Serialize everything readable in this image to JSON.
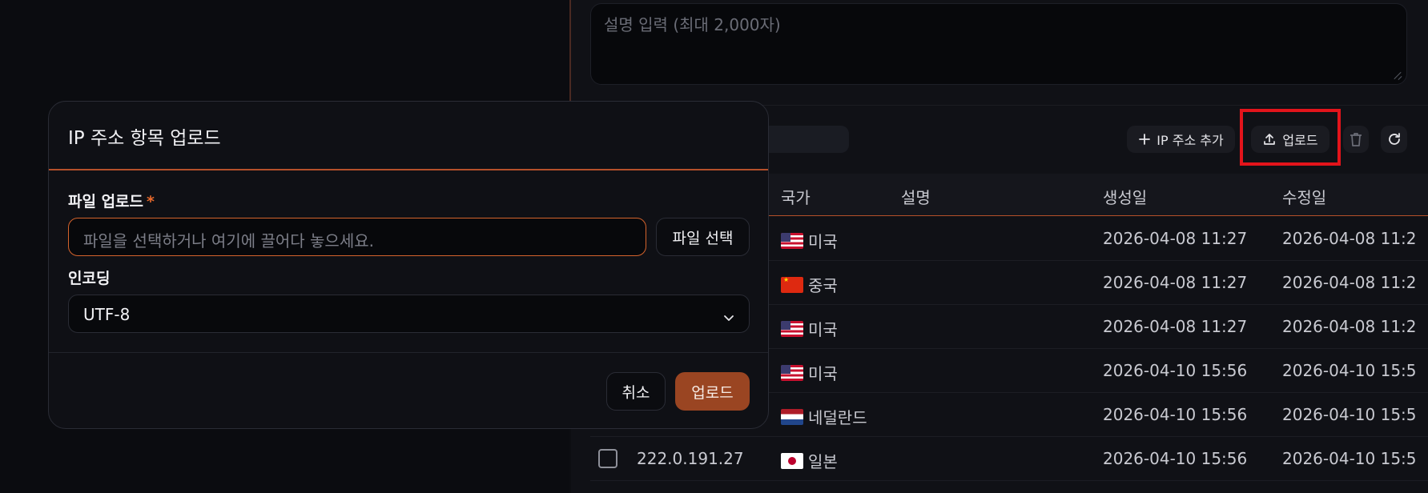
{
  "background": {
    "description_placeholder": "설명 입력 (최대 2,000자)"
  },
  "toolbar": {
    "add_ip_label": "IP 주소 추가",
    "upload_label": "업로드"
  },
  "table": {
    "headers": {
      "country": "국가",
      "description": "설명",
      "created": "생성일",
      "modified": "수정일"
    },
    "rows": [
      {
        "ip": "",
        "country": "미국",
        "flag": "us",
        "created": "2026-04-08 11:27",
        "modified": "2026-04-08 11:2"
      },
      {
        "ip": "",
        "country": "중국",
        "flag": "cn",
        "created": "2026-04-08 11:27",
        "modified": "2026-04-08 11:2"
      },
      {
        "ip": "",
        "country": "미국",
        "flag": "us",
        "created": "2026-04-08 11:27",
        "modified": "2026-04-08 11:2"
      },
      {
        "ip": "",
        "country": "미국",
        "flag": "us",
        "created": "2026-04-10 15:56",
        "modified": "2026-04-10 15:5"
      },
      {
        "ip": "",
        "country": "네덜란드",
        "flag": "nl",
        "created": "2026-04-10 15:56",
        "modified": "2026-04-10 15:5"
      },
      {
        "ip": "222.0.191.27",
        "country": "일본",
        "flag": "jp",
        "created": "2026-04-10 15:56",
        "modified": "2026-04-10 15:5"
      }
    ]
  },
  "modal": {
    "title": "IP 주소 항목 업로드",
    "file_label": "파일 업로드",
    "required_mark": "*",
    "file_placeholder": "파일을 선택하거나 여기에 끌어다 놓으세요.",
    "file_select_label": "파일 선택",
    "encoding_label": "인코딩",
    "encoding_value": "UTF-8",
    "cancel_label": "취소",
    "upload_label": "업로드"
  },
  "colors": {
    "accent": "#b5502a",
    "primary_button": "#9a4522",
    "highlight": "#e3141b"
  }
}
